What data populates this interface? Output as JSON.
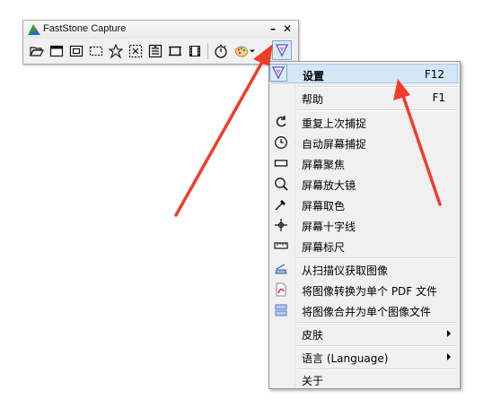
{
  "window": {
    "title": "FastStone Capture",
    "minimize_glyph": "–",
    "close_glyph": "✕"
  },
  "toolbar": {
    "buttons": [
      {
        "icon": "open-folder-icon"
      },
      {
        "icon": "capture-active-window-icon"
      },
      {
        "icon": "capture-window-object-icon"
      },
      {
        "icon": "capture-rectangle-icon"
      },
      {
        "icon": "capture-freehand-icon"
      },
      {
        "icon": "capture-fullscreen-icon"
      },
      {
        "icon": "capture-scrolling-window-icon"
      },
      {
        "icon": "capture-fixed-region-icon"
      },
      {
        "icon": "screen-recorder-icon"
      },
      {
        "icon": "delay-timer-icon"
      },
      {
        "icon": "output-palette-icon"
      },
      {
        "icon": "settings-menu-icon"
      }
    ]
  },
  "menu": {
    "items": [
      {
        "label": "设置",
        "shortcut": "F12",
        "icon": "settings-icon",
        "bold": true,
        "highlight": true
      },
      {
        "label": "帮助",
        "shortcut": "F1",
        "icon": ""
      },
      {
        "label": "重复上次捕捉",
        "icon": "repeat-icon"
      },
      {
        "label": "自动屏幕捕捉",
        "icon": "clock-icon"
      },
      {
        "label": "屏幕聚焦",
        "icon": "focus-rect-icon"
      },
      {
        "label": "屏幕放大镜",
        "icon": "magnifier-icon"
      },
      {
        "label": "屏幕取色",
        "icon": "eyedropper-icon"
      },
      {
        "label": "屏幕十字线",
        "icon": "crosshair-icon"
      },
      {
        "label": "屏幕标尺",
        "icon": "ruler-icon"
      },
      {
        "label": "从扫描仪获取图像",
        "icon": "scanner-icon"
      },
      {
        "label": "将图像转换为单个 PDF 文件",
        "icon": "pdf-icon"
      },
      {
        "label": "将图像合并为单个图像文件",
        "icon": "combine-icon"
      },
      {
        "label": "皮肤",
        "icon": "",
        "submenu": true
      },
      {
        "label": "语言 (Language)",
        "icon": "",
        "submenu": true
      },
      {
        "label": "关于",
        "icon": ""
      }
    ]
  },
  "colors": {
    "accent_arrow": "#f03c2a",
    "highlight_bg": "#d5e6f7",
    "highlight_border": "#a9c8ea"
  }
}
